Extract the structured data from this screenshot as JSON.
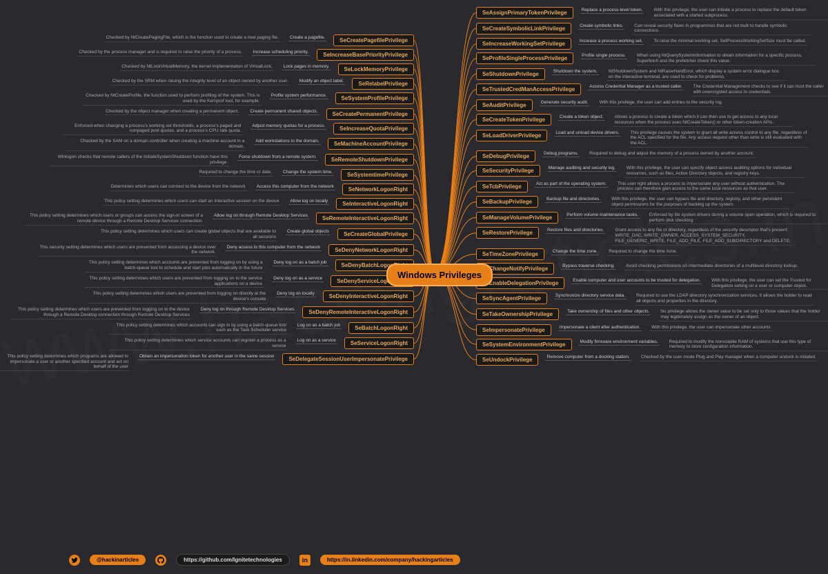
{
  "title": "Windows Privileges",
  "watermark": "www.hackingarticles.in",
  "left": [
    {
      "name": "SeCreatePagefilePrivilege",
      "short": "Create a pagefile.",
      "long": "Checked by NtCreatePagingFile, which is the function used to create a new paging file."
    },
    {
      "name": "SeIncreaseBasePriorityPrivilege",
      "short": "Increase scheduling priority.",
      "long": "Checked by the process manager and is required to raise the priority of a process."
    },
    {
      "name": "SeLockMemoryPrivilege",
      "short": "Lock pages in memory.",
      "long": "Checked by NtLockVirtualMemory, the kernel implementation of VirtualLock."
    },
    {
      "name": "SeRelabelPrivilege",
      "short": "Modify an object label.",
      "long": "Checked by the SRM when raising the integrity level of an object owned by another user."
    },
    {
      "name": "SeSystemProfilePrivilege",
      "short": "Profile system performance.",
      "long": "Checked by NtCreateProfile, the function used to perform profiling of the system. This is used by the Kernprof tool, for example."
    },
    {
      "name": "SeCreatePermanentPrivilege",
      "short": "Create permanent shared objects.",
      "long": "Checked by the object manager when creating a permanent object."
    },
    {
      "name": "SeIncreaseQuotaPrivilege",
      "short": "Adjust memory quotas for a process.",
      "long": "Enforced when changing a process's working set thresholds, a process's paged and nonpaged pool quotas, and a process's CPU rate quota."
    },
    {
      "name": "SeMachineAccountPrivilege",
      "short": "Add workstations to the domain.",
      "long": "Checked by the SAM on a domain controller when creating a machine account in a domain."
    },
    {
      "name": "SeRemoteShutdownPrivilege",
      "short": "Force shutdown from a remote system.",
      "long": "Winlogon checks that remote callers of the InitiateSystemShutdown function have this privilege."
    },
    {
      "name": "SeSystemtimePrivilege",
      "short": "Change the system time.",
      "long": "Required to change the time or date."
    },
    {
      "name": "SeNetworkLogonRight",
      "short": "Access this computer from the network",
      "long": "Determines which users can connect to the device from the network"
    },
    {
      "name": "SeInteractiveLogonRight",
      "short": "Allow log on locally",
      "long": "This policy setting determines which users can start an interactive session on the device"
    },
    {
      "name": "SeRemoteInteractiveLogonRight",
      "short": "Allow log on through Remote Desktop Services",
      "long": "This policy setting determines which users or groups can access the sign-in screen of a remote device through a Remote Desktop Services connection."
    },
    {
      "name": "SeCreateGlobalPrivilege",
      "short": "Create global objects",
      "long": "This policy setting determines which users can create global objects that are available to all sessions"
    },
    {
      "name": "SeDenyNetworkLogonRight",
      "short": "Deny access to this computer from the network",
      "long": "This security setting determines which users are prevented from accessing a device over the network."
    },
    {
      "name": "SeDenyBatchLogonRight",
      "short": "Deny log on as a batch job",
      "long": "This policy setting determines which accounts are prevented from logging on by using a batch-queue tool to schedule and start jobs automatically in the future"
    },
    {
      "name": "SeDenyServiceLogonRight",
      "short": "Deny log on as a service",
      "long": "This policy setting determines which users are prevented from logging on to the service applications on a device"
    },
    {
      "name": "SeDenyInteractiveLogonRight",
      "short": "Deny log on locally",
      "long": "This policy setting determines which users are prevented from logging on directly at the device's console"
    },
    {
      "name": "SeDenyRemoteInteractiveLogonRight",
      "short": "Deny log on through Remote Desktop Services",
      "long": "This policy setting determines which users are prevented from logging on to the device through a Remote Desktop connection through Remote Desktop Services"
    },
    {
      "name": "SeBatchLogonRight",
      "short": "Log on as a batch job",
      "long": "This policy setting determines which accounts can sign in by using a batch-queue tool such as the Task Scheduler service"
    },
    {
      "name": "SeServiceLogonRight",
      "short": "Log on as a service",
      "long": "This policy setting determines which service accounts can register a process as a service"
    },
    {
      "name": "SeDelegateSessionUserImpersonatePrivilege",
      "short": "Obtain an impersonation token for another user in the same session",
      "long": "This policy setting determines which programs are allowed to impersonate a user or another specified account and act on behalf of the user"
    }
  ],
  "right": [
    {
      "name": "SeAssignPrimaryTokenPrivilege",
      "short": "Replace a process-level token.",
      "long": "With this privilege, the user can initiate a process to replace the default token associated with a started subprocess."
    },
    {
      "name": "SeCreateSymbolicLinkPrivilege",
      "short": "Create symbolic links.",
      "long": "Can reveal security flaws in programmes that are not built to handle symbolic connections."
    },
    {
      "name": "SeIncreaseWorkingSetPrivilege",
      "short": "Increase a process working set.",
      "long": "To raise the minimal working set, SetProcessWorkingSetSize must be called."
    },
    {
      "name": "SeProfileSingleProcessPrivilege",
      "short": "Profile single process.",
      "long": "When using NtQuerySystemInformation to obtain information for a specific process, Superfetch and the prefetcher check this value."
    },
    {
      "name": "SeShutdownPrivilege",
      "short": "Shutdown the system.",
      "long": "NtShutdownSystem and NtRaiseHardError, which display a system error dialogue box on the interactive terminal, are used to check for problems."
    },
    {
      "name": "SeTrustedCredManAccessPrivilege",
      "short": "Access Credential Manager as a trusted caller.",
      "long": "The Credential Management checks to see if it can trust the caller with unencrypted access to credentials."
    },
    {
      "name": "SeAuditPrivilege",
      "short": "Generate security audit.",
      "long": "With this privilege, the user can add entries to the security log."
    },
    {
      "name": "SeCreateTokenPrivilege",
      "short": "Create a token object.",
      "long": "Allows a process to create a token which it can then use to get access to any local resources when the process uses NtCreateToken() or other token-creation APIs."
    },
    {
      "name": "SeLoadDriverPrivilege",
      "short": "Load and unload device drivers.",
      "long": "This privilege causes the system to grant all write access control to any file, regardless of the ACL specified for the file. Any access request other than write is still evaluated with the ACL."
    },
    {
      "name": "SeDebugPrivilege",
      "short": "Debug programs.",
      "long": "Required to debug and adjust the memory of a process owned by another account."
    },
    {
      "name": "SeSecurityPrivilege",
      "short": "Manage auditing and security log.",
      "long": "With this privilege, the user can specify object access auditing options for individual resources, such as files, Active Directory objects, and registry keys."
    },
    {
      "name": "SeTcbPrivilege",
      "short": "Act as part of the operating system.",
      "long": "This user right allows a process to impersonate any user without authentication. The process can therefore gain access to the same local resources as that user."
    },
    {
      "name": "SeBackupPrivilege",
      "short": "Backup file and directories.",
      "long": "With this privilege, the user can bypass file and directory, registry, and other persistent object permissions for the purposes of backing up the system."
    },
    {
      "name": "SeManageVolumePrivilege",
      "short": "Perform volume maintenance tasks.",
      "long": "Enforced by file system drivers during a volume open operation, which is required to perform disk checking."
    },
    {
      "name": "SeRestorePrivilege",
      "short": "Restore files and directories.",
      "long": "Grant access to any file or directory, regardless of the security descriptor that's present: WRITE_DAC, WRITE_OWNER, ACCESS_SYSTEM_SECURITY, FILE_GENERIC_WRITE, FILE_ADD_FILE, FILE_ADD_SUBDIRECTORY and DELETE."
    },
    {
      "name": "SeTimeZonePrivilege",
      "short": "Change the time zone.",
      "long": "Required to change the time zone."
    },
    {
      "name": "SeChangeNotifyPrivilege",
      "short": "Bypass traverse checking.",
      "long": "Avoid checking permissions on intermediate directories of a multilevel directory lookup."
    },
    {
      "name": "SeEnableDelegationPrivilege",
      "short": "Enable computer and user accounts to be trusted for delegation.",
      "long": "With this privilege, the user can set the Trusted for Delegation setting on a user or computer object."
    },
    {
      "name": "SeSyncAgentPrivilege",
      "short": "Synchronize directory service data.",
      "long": "Required to use the LDAP directory synchronization services. It allows the holder to read all objects and properties in the directory."
    },
    {
      "name": "SeTakeOwnershipPrivilege",
      "short": "Take ownership of files and other objects.",
      "long": "his privilege allows the owner value to be set only to those values that the holder may legitimately assign as the owner of an object."
    },
    {
      "name": "SeImpersonatePrivilege",
      "short": "Impersonate a client after authentication.",
      "long": "With this privilege, the user can impersonate other accounts."
    },
    {
      "name": "SeSystemEnvironmentPrivilege",
      "short": "Modify firmware environment variables.",
      "long": "Required to modify the nonvolatile RAM of systems that use this type of memory to store configuration information."
    },
    {
      "name": "SeUndockPrivilege",
      "short": "Remove computer from a docking station.",
      "long": "Checked by the user-mode Plug and Play manager when a computer undock is initiated."
    }
  ],
  "footer": {
    "twitter": "@hackinarticles",
    "github": "https://github.com/Ignitetechnologies",
    "linkedin": "https://in.linkedin.com/company/hackingarticles"
  }
}
